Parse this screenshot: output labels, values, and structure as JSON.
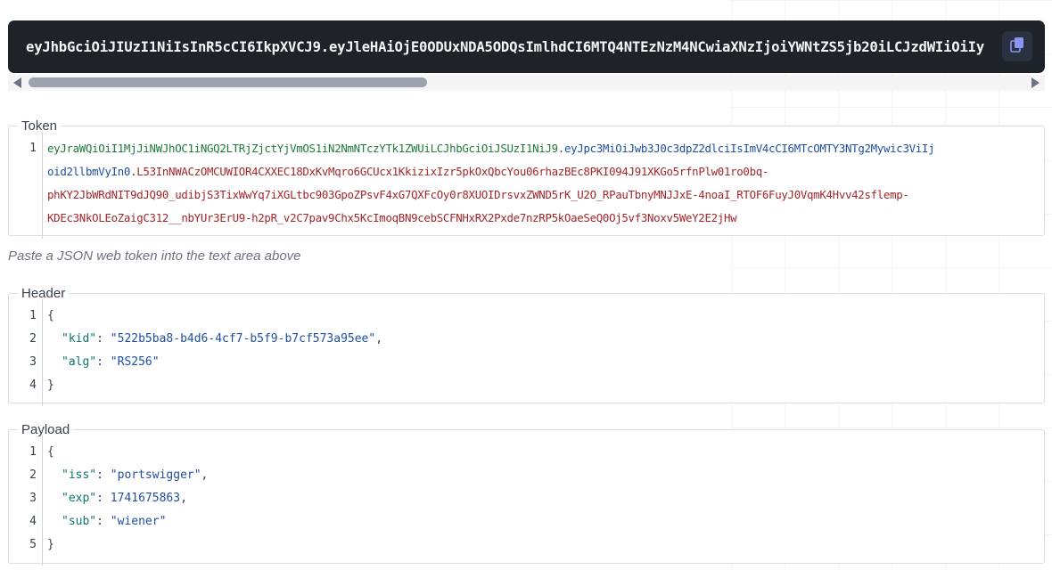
{
  "encoded_token_display": "eyJhbGciOiJIUzI1NiIsInR5cCI6IkpXVCJ9.eyJleHAiOjE0ODUxNDA5ODQsImlhdCI6MTQ4NTEzNzM4NCwiaXNzIjoiYWNtZS5jb20iLCJzdWIiOiIy",
  "token_panel": {
    "legend": "Token",
    "line_number": "1",
    "header_part": "eyJraWQiOiI1MjJiNWJhOC1iNGQ2LTRjZjctYjVmOS1iN2NmNTczYTk1ZWUiLCJhbGciOiJSUzI1NiJ9",
    "payload_part": "eyJpc3MiOiJwb3J0c3dpZ2dlciIsImV4cCI6MTcOMTY3NTg2Mywic3ViIjoid2llbmVyIn0",
    "signature_part": "L53InNWACzOMCUWIOR4CXXEC18DxKvMqro6GCUcx1KkizixIzr5pkOxQbcYou06rhazBEc8PKI094J91XKGo5rfnPlw01ro0bq-phKY2JbWRdNIT9dJQ90_udibjS3TixWwYq7iXGLtbc903GpoZPsvF4xG7QXFcOy0r8XUOIDrsvxZWND5rK_U2O_RPauTbnyMNJJxE-4noaI_RTOF6FuyJ0VqmK4Hvv42sflemp-KDEc3NkOLEoZaigC312__nbYUr3ErU9-h2pR_v2C7pav9Chx5KcImoqBN9cebSCFNHxRX2Pxde7nzRP5kOaeSeQ0Oj5vf3Noxv5WeY2E2jHw",
    "separator": ".",
    "wrapped_lines": [
      "eyJraWQiOiI1MjJiNWJhOC1iNGQ2LTRjZjctYjVmOS1iN2NmNTczYTk1ZWUiLCJhbGciOiJSUzI1NiJ9.eyJpc3MiOiJwb3J0c3dpZ2dlciIsImV4cCI6MTcOMTY3NTg2Mywic3ViIj",
      "oid2llbmVyIn0.L53InNWACzOMCUWIOR4CXXEC18DxKvMqro6GCUcx1KkizixIzr5pkOxQbcYou06rhazBEc8PKI094J91XKGo5rfnPlw01ro0bq-",
      "phKY2JbWRdNIT9dJQ90_udibjS3TixWwYq7iXGLtbc903GpoZPsvF4xG7QXFcOy0r8XUOIDrsvxZWND5rK_U2O_RPauTbnyMNJJxE-4noaI_RTOF6FuyJ0VqmK4Hvv42sflemp-",
      "KDEc3NkOLEoZaigC312__nbYUr3ErU9-h2pR_v2C7pav9Chx5KcImoqBN9cebSCFNHxRX2Pxde7nzRP5kOaeSeQ0Oj5vf3Noxv5WeY2E2jHw"
    ]
  },
  "hint_text": "Paste a JSON web token into the text area above",
  "header_panel": {
    "legend": "Header",
    "line_numbers": [
      "1",
      "2",
      "3",
      "4"
    ],
    "open_brace": "{",
    "close_brace": "}",
    "fields": [
      {
        "key": "\"kid\"",
        "colon": ": ",
        "value": "\"522b5ba8-b4d6-4cf7-b5f9-b7cf573a95ee\"",
        "comma": ","
      },
      {
        "key": "\"alg\"",
        "colon": ": ",
        "value": "\"RS256\"",
        "comma": ""
      }
    ]
  },
  "payload_panel": {
    "legend": "Payload",
    "line_numbers": [
      "1",
      "2",
      "3",
      "4",
      "5"
    ],
    "open_brace": "{",
    "close_brace": "}",
    "fields": [
      {
        "key": "\"iss\"",
        "colon": ": ",
        "value": "\"portswigger\"",
        "comma": ","
      },
      {
        "key": "\"exp\"",
        "colon": ": ",
        "value": "1741675863",
        "comma": ","
      },
      {
        "key": "\"sub\"",
        "colon": ": ",
        "value": "\"wiener\"",
        "comma": ""
      }
    ]
  },
  "colors": {
    "token_bar_bg": "#1e2329",
    "header_segment": "#1f7a3a",
    "payload_segment": "#1f4fa0",
    "signature_segment": "#a3262a",
    "json_key": "#0f766e",
    "copy_icon": "#8b93f5"
  },
  "icons": {
    "copy": "copy-icon",
    "scroll_left": "arrow-left-icon",
    "scroll_right": "arrow-right-icon"
  }
}
